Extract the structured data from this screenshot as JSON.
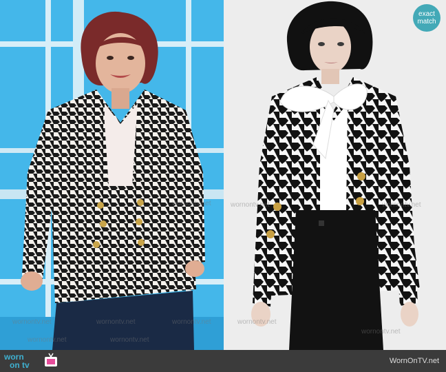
{
  "badge": {
    "line1": "exact",
    "line2": "match",
    "color": "#43a9b7"
  },
  "watermark": {
    "text": "wornontv.net"
  },
  "footer": {
    "logo_line1": "worn",
    "logo_line2": "on tv",
    "site": "WornOnTV.net",
    "background": "#3b3b3b",
    "accent": "#3fb0d0"
  },
  "colors": {
    "studio_blue": "#3fb4e8",
    "backdrop": "#eeeeee"
  }
}
